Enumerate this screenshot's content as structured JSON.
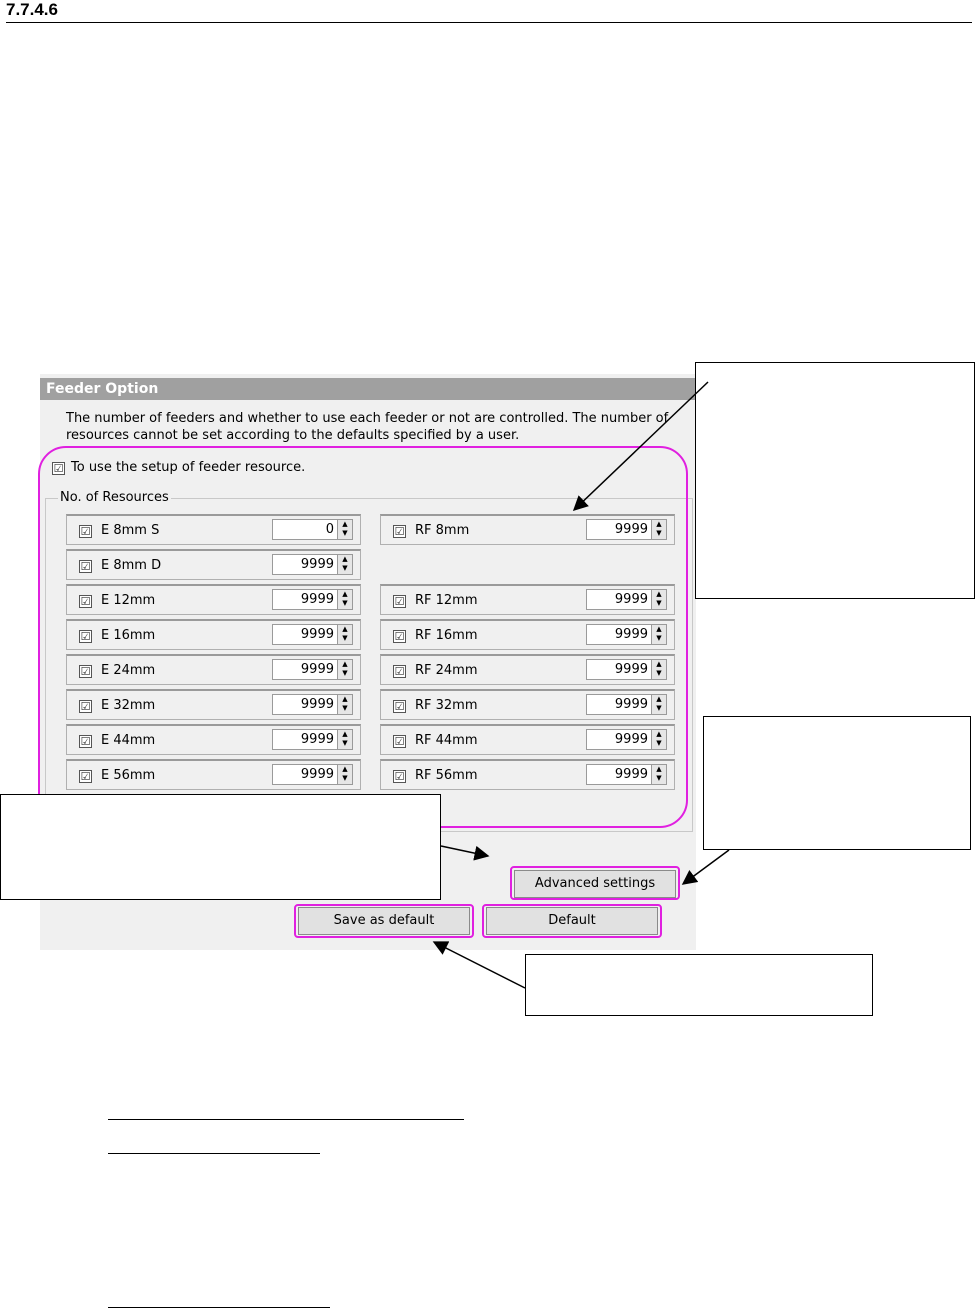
{
  "section": {
    "number": "7.7.4.6"
  },
  "dialog": {
    "title": "Feeder Option",
    "description": "The number of feeders and whether to use each feeder or not are controlled.  The number of resources cannot be set according to the defaults specified by a user.",
    "use_setup_label": "To use the setup of feeder resource.",
    "use_setup_checked": "☑",
    "group_label": "No. of Resources",
    "left_items": [
      {
        "label": "E 8mm S",
        "value": "0"
      },
      {
        "label": "E 8mm D",
        "value": "9999"
      },
      {
        "label": "E 12mm",
        "value": "9999"
      },
      {
        "label": "E 16mm",
        "value": "9999"
      },
      {
        "label": "E 24mm",
        "value": "9999"
      },
      {
        "label": "E 32mm",
        "value": "9999"
      },
      {
        "label": "E 44mm",
        "value": "9999"
      },
      {
        "label": "E 56mm",
        "value": "9999"
      }
    ],
    "right_items": [
      {
        "label": "RF 8mm",
        "value": "9999"
      },
      null,
      {
        "label": "RF 12mm",
        "value": "9999"
      },
      {
        "label": "RF 16mm",
        "value": "9999"
      },
      {
        "label": "RF 24mm",
        "value": "9999"
      },
      {
        "label": "RF 32mm",
        "value": "9999"
      },
      {
        "label": "RF 44mm",
        "value": "9999"
      },
      {
        "label": "RF 56mm",
        "value": "9999"
      }
    ],
    "advanced_label": "Advanced settings",
    "save_default_label": "Save as default",
    "default_label": "Default"
  },
  "colors": {
    "highlight": "#e020e0",
    "title_bar": "#a0a0a0",
    "dialog_bg": "#f0f0f0"
  }
}
